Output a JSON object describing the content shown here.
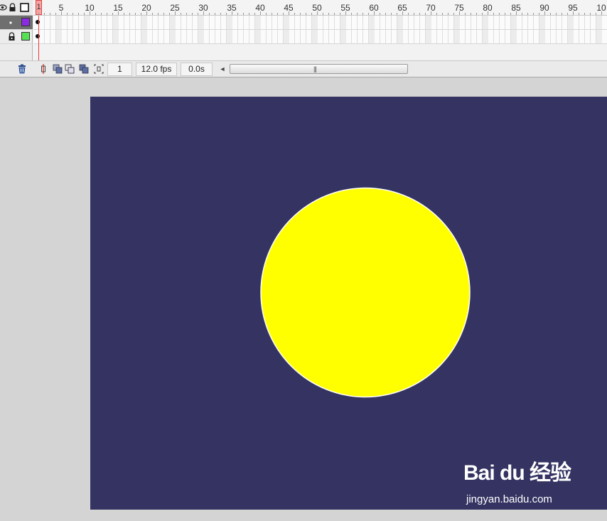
{
  "timeline": {
    "ruler_ticks": [
      "1",
      "5",
      "10",
      "15",
      "20",
      "25",
      "30",
      "35",
      "40",
      "45",
      "50",
      "55",
      "60",
      "65",
      "70",
      "75",
      "80",
      "85",
      "90",
      "95",
      "10"
    ],
    "current_frame": "1",
    "frame_rate": "12.0 fps",
    "elapsed_time": "0.0s",
    "layers": [
      {
        "outline_color": "#8a2be2",
        "selected": true
      },
      {
        "outline_color": "#55e055",
        "selected": false
      }
    ],
    "icons": {
      "header": [
        "eye-icon",
        "lock-icon",
        "outline-icon"
      ],
      "status": [
        "trash-icon",
        "center-frame-icon",
        "onion-skin-icon",
        "onion-skin-outlines-icon",
        "edit-multiple-frames-icon",
        "modify-onion-markers-icon"
      ]
    }
  },
  "stage": {
    "background_color": "#343362",
    "shape": {
      "fill": "#ffff00",
      "stroke": "#ffffff"
    }
  },
  "watermark": {
    "logo_text": "Bai du 经验",
    "url": "jingyan.baidu.com"
  }
}
